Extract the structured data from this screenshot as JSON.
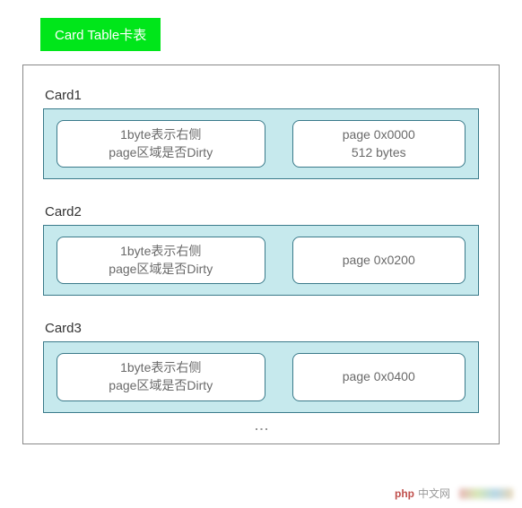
{
  "title": "Card Table卡表",
  "cards": [
    {
      "label": "Card1",
      "left": "1byte表示右侧\npage区域是否Dirty",
      "right": "page 0x0000\n512 bytes"
    },
    {
      "label": "Card2",
      "left": "1byte表示右侧\npage区域是否Dirty",
      "right": "page 0x0200"
    },
    {
      "label": "Card3",
      "left": "1byte表示右侧\npage区域是否Dirty",
      "right": "page 0x0400"
    }
  ],
  "ellipsis": "⋮",
  "watermark": {
    "prefix": "php",
    "text": "中文网"
  }
}
